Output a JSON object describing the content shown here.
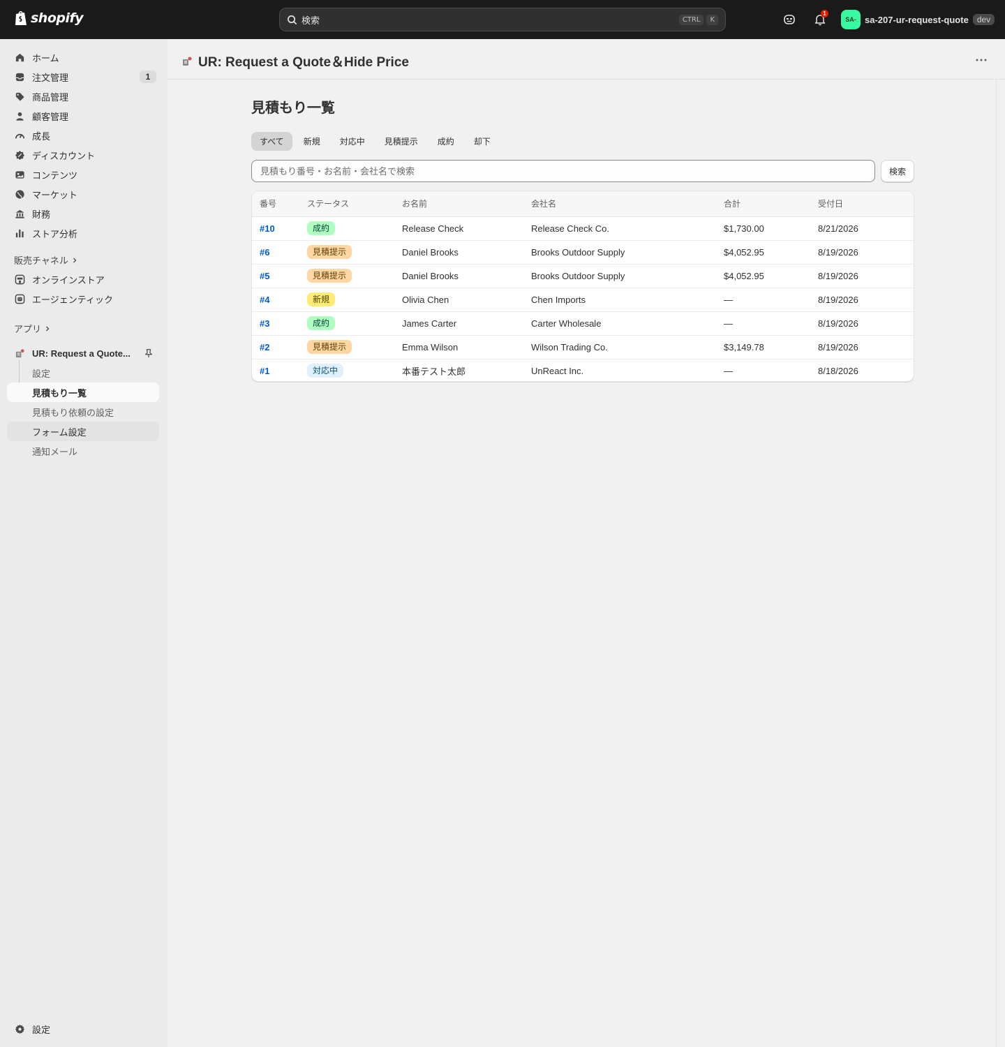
{
  "topbar": {
    "logo_text": "shopify",
    "search_placeholder": "検索",
    "shortcut_ctrl": "CTRL",
    "shortcut_k": "K",
    "notification_count": "1",
    "avatar_initials": "SA-",
    "store_name": "sa-207-ur-request-quote",
    "env_badge": "dev"
  },
  "sidebar": {
    "items": [
      {
        "label": "ホーム",
        "icon": "home-icon"
      },
      {
        "label": "注文管理",
        "icon": "inbox-icon",
        "count": "1"
      },
      {
        "label": "商品管理",
        "icon": "tag-icon"
      },
      {
        "label": "顧客管理",
        "icon": "person-icon"
      },
      {
        "label": "成長",
        "icon": "gauge-icon"
      },
      {
        "label": "ディスカウント",
        "icon": "discount-icon"
      },
      {
        "label": "コンテンツ",
        "icon": "content-icon"
      },
      {
        "label": "マーケット",
        "icon": "globe-icon"
      },
      {
        "label": "財務",
        "icon": "bank-icon"
      },
      {
        "label": "ストア分析",
        "icon": "chart-icon"
      }
    ],
    "sales_channels_label": "販売チャネル",
    "channels": [
      {
        "label": "オンラインストア",
        "icon": "store-icon"
      },
      {
        "label": "エージェンティック",
        "icon": "agent-icon"
      }
    ],
    "apps_label": "アプリ",
    "app_name": "UR: Request a Quote...",
    "app_subitems": [
      {
        "label": "設定"
      },
      {
        "label": "見積もり一覧"
      },
      {
        "label": "見積もり依頼の設定"
      },
      {
        "label": "フォーム設定"
      },
      {
        "label": "通知メール"
      }
    ],
    "settings_label": "設定"
  },
  "header": {
    "app_title": "UR: Request a Quote＆Hide Price"
  },
  "main": {
    "page_title": "見積もり一覧",
    "tabs": [
      "すべて",
      "新規",
      "対応中",
      "見積提示",
      "成約",
      "却下"
    ],
    "filter_placeholder": "見積もり番号・お名前・会社名で検索",
    "search_button": "検索",
    "columns": [
      "番号",
      "ステータス",
      "お名前",
      "会社名",
      "合計",
      "受付日"
    ],
    "rows": [
      {
        "number": "#10",
        "status": "成約",
        "status_kind": "won",
        "name": "Release Check",
        "company": "Release Check Co.",
        "total": "$1,730.00",
        "date": "8/21/2026"
      },
      {
        "number": "#6",
        "status": "見積提示",
        "status_kind": "quoted",
        "name": "Daniel Brooks",
        "company": "Brooks Outdoor Supply",
        "total": "$4,052.95",
        "date": "8/19/2026"
      },
      {
        "number": "#5",
        "status": "見積提示",
        "status_kind": "quoted",
        "name": "Daniel Brooks",
        "company": "Brooks Outdoor Supply",
        "total": "$4,052.95",
        "date": "8/19/2026"
      },
      {
        "number": "#4",
        "status": "新規",
        "status_kind": "new",
        "name": "Olivia Chen",
        "company": "Chen Imports",
        "total": "—",
        "date": "8/19/2026"
      },
      {
        "number": "#3",
        "status": "成約",
        "status_kind": "won",
        "name": "James Carter",
        "company": "Carter Wholesale",
        "total": "—",
        "date": "8/19/2026"
      },
      {
        "number": "#2",
        "status": "見積提示",
        "status_kind": "quoted",
        "name": "Emma Wilson",
        "company": "Wilson Trading Co.",
        "total": "$3,149.78",
        "date": "8/19/2026"
      },
      {
        "number": "#1",
        "status": "対応中",
        "status_kind": "progress",
        "name": "本番テスト太郎",
        "company": "UnReact Inc.",
        "total": "—",
        "date": "8/18/2026"
      }
    ]
  },
  "colors": {
    "topbar": "#1a1a1a",
    "link": "#005bd3",
    "won": "#affebf",
    "quoted": "#ffd6a4",
    "new": "#ffeb78",
    "progress": "#e0f0ff"
  }
}
